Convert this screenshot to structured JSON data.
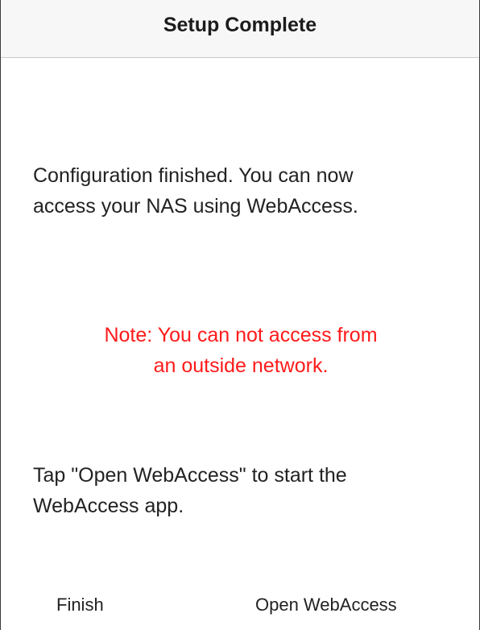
{
  "header": {
    "title": "Setup Complete"
  },
  "content": {
    "config_line1": "Configuration finished. You can now",
    "config_line2": "access your NAS using WebAccess.",
    "note_line1": "Note: You can not access from",
    "note_line2": "an outside network.",
    "tap_line1": "Tap \"Open WebAccess\" to start the",
    "tap_line2": "WebAccess app."
  },
  "footer": {
    "finish_label": "Finish",
    "open_label": "Open WebAccess"
  },
  "colors": {
    "note": "#ff1a1a",
    "text": "#222222",
    "nav_background": "#f7f7f7"
  }
}
